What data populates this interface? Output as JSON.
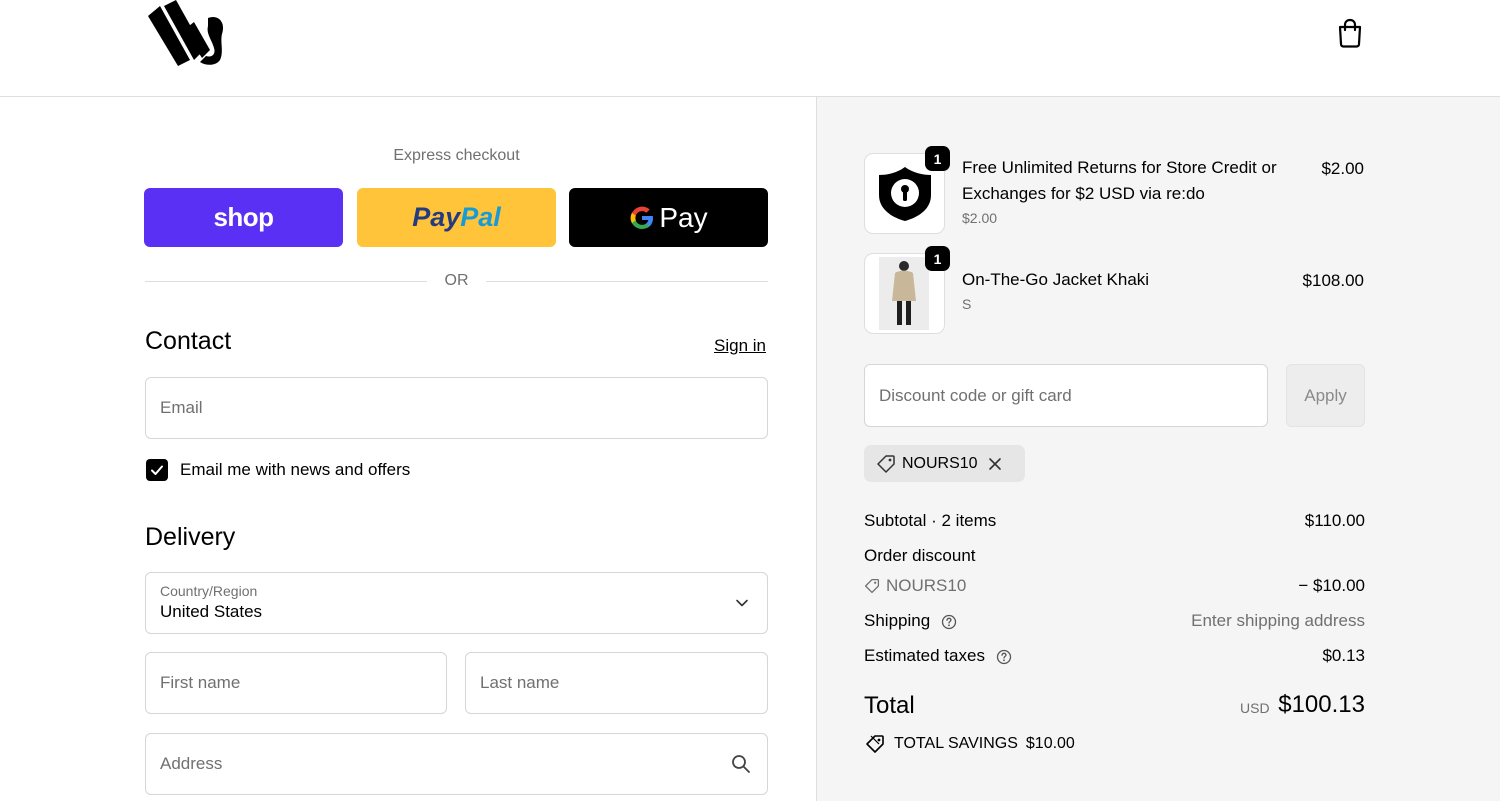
{
  "header": {
    "logo_icon": "brand-logo",
    "cart_icon": "shopping-bag-icon"
  },
  "express": {
    "title": "Express checkout",
    "shop_label": "shop",
    "paypal_part1": "Pay",
    "paypal_part2": "Pal",
    "gpay_label": "Pay",
    "or_label": "OR"
  },
  "contact": {
    "title": "Contact",
    "sign_in": "Sign in",
    "email_placeholder": "Email",
    "news_label": "Email me with news and offers",
    "news_checked": true
  },
  "delivery": {
    "title": "Delivery",
    "country_label": "Country/Region",
    "country_value": "United States",
    "first_name_placeholder": "First name",
    "last_name_placeholder": "Last name",
    "address_placeholder": "Address"
  },
  "order": {
    "items": [
      {
        "name_line1": "Free Unlimited Returns for Store Credit or",
        "name_line2": "Exchanges for $2 USD via re:do",
        "sub": "$2.00",
        "price": "$2.00",
        "qty": "1"
      },
      {
        "name_line1": "On-The-Go Jacket Khaki",
        "name_line2": "",
        "sub": "S",
        "price": "$108.00",
        "qty": "1"
      }
    ],
    "discount_placeholder": "Discount code or gift card",
    "apply_label": "Apply",
    "applied_code": "NOURS10",
    "subtotal_label": "Subtotal · 2 items",
    "subtotal_value": "$110.00",
    "order_discount_label": "Order discount",
    "discount_code": "NOURS10",
    "discount_value": "− $10.00",
    "shipping_label": "Shipping",
    "shipping_value": "Enter shipping address",
    "taxes_label": "Estimated taxes",
    "taxes_value": "$0.13",
    "total_label": "Total",
    "total_currency": "USD",
    "total_value": "$100.13",
    "savings_label": "TOTAL SAVINGS",
    "savings_value": "$10.00"
  },
  "colors": {
    "shop": "#5a31f4",
    "paypal": "#ffc439",
    "gpay": "#000000",
    "summary_bg": "#f5f5f5"
  }
}
